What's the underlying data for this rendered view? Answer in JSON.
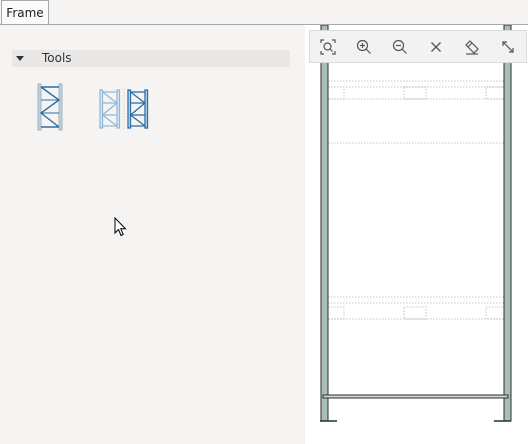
{
  "tabs": [
    {
      "label": "Frame",
      "active": true
    }
  ],
  "tools_panel": {
    "section_title": "Tools",
    "expanded": true,
    "items": [
      {
        "name": "frame-tool"
      },
      {
        "name": "double-frame-tool"
      }
    ]
  },
  "toolbar": {
    "buttons": [
      {
        "icon": "zoom-extents-icon"
      },
      {
        "icon": "zoom-in-icon"
      },
      {
        "icon": "zoom-out-icon"
      },
      {
        "icon": "close-icon"
      },
      {
        "icon": "eraser-icon"
      },
      {
        "icon": "resize-icon"
      }
    ]
  },
  "colors": {
    "upright_fill": "#a9bfb4",
    "upright_stroke": "#2d2d2d",
    "tool_blue": "#2a6fa8",
    "tool_light_blue": "#8db5d8",
    "dotted_line": "#b5b5b5"
  }
}
